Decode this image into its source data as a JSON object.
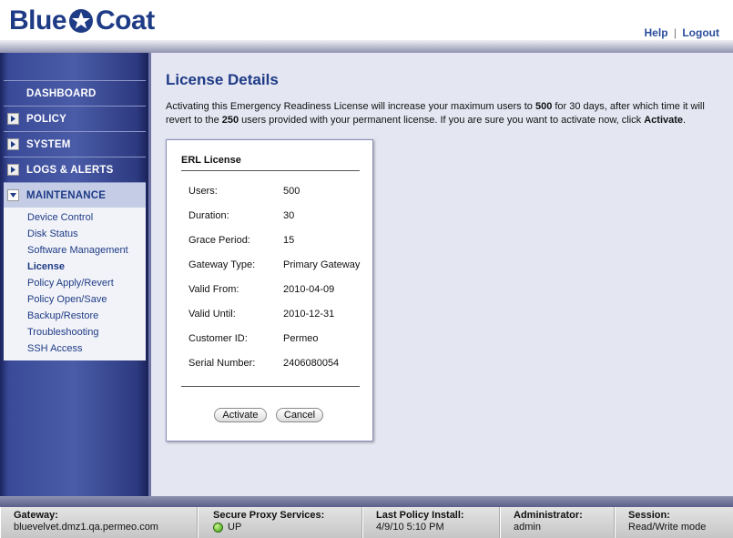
{
  "brand": {
    "name_part1": "Blue",
    "name_part2": "Coat",
    "color": "#1e3b86"
  },
  "top_links": {
    "help": "Help",
    "separator": "|",
    "logout": "Logout"
  },
  "sidebar": {
    "items": [
      {
        "label": "DASHBOARD",
        "icon": "none"
      },
      {
        "label": "POLICY",
        "icon": "arrow-right-icon"
      },
      {
        "label": "SYSTEM",
        "icon": "arrow-right-icon"
      },
      {
        "label": "LOGS & ALERTS",
        "icon": "arrow-right-icon"
      },
      {
        "label": "MAINTENANCE",
        "icon": "arrow-down-icon"
      }
    ],
    "subitems": [
      "Device Control",
      "Disk Status",
      "Software Management",
      "License",
      "Policy Apply/Revert",
      "Policy Open/Save",
      "Backup/Restore",
      "Troubleshooting",
      "SSH Access"
    ],
    "current_subitem": "License"
  },
  "main": {
    "title": "License Details",
    "description": {
      "p1": "Activating this Emergency Readiness License will increase your maximum users to ",
      "b1": "500",
      "p2": " for 30 days, after which time it will revert to the ",
      "b2": "250",
      "p3": " users provided with your permanent license. If you are sure you want to activate now, click ",
      "b3": "Activate",
      "p4": "."
    }
  },
  "license": {
    "title": "ERL License",
    "rows": [
      {
        "label": "Users:",
        "value": "500"
      },
      {
        "label": "Duration:",
        "value": "30"
      },
      {
        "label": "Grace Period:",
        "value": "15"
      },
      {
        "label": "Gateway Type:",
        "value": "Primary Gateway"
      },
      {
        "label": "Valid From:",
        "value": "2010-04-09"
      },
      {
        "label": "Valid Until:",
        "value": "2010-12-31"
      },
      {
        "label": "Customer ID:",
        "value": "Permeo"
      },
      {
        "label": "Serial Number:",
        "value": "2406080054"
      }
    ],
    "activate_label": "Activate",
    "cancel_label": "Cancel"
  },
  "status": {
    "gateway": {
      "label": "Gateway:",
      "value": "bluevelvet.dmz1.qa.permeo.com"
    },
    "proxy": {
      "label": "Secure Proxy Services:",
      "value": "UP",
      "led_color": "#3f9b12"
    },
    "last_install": {
      "label": "Last Policy Install:",
      "value": "4/9/10 5:10 PM"
    },
    "admin": {
      "label": "Administrator:",
      "value": "admin"
    },
    "session": {
      "label": "Session:",
      "value": "Read/Write mode"
    }
  }
}
